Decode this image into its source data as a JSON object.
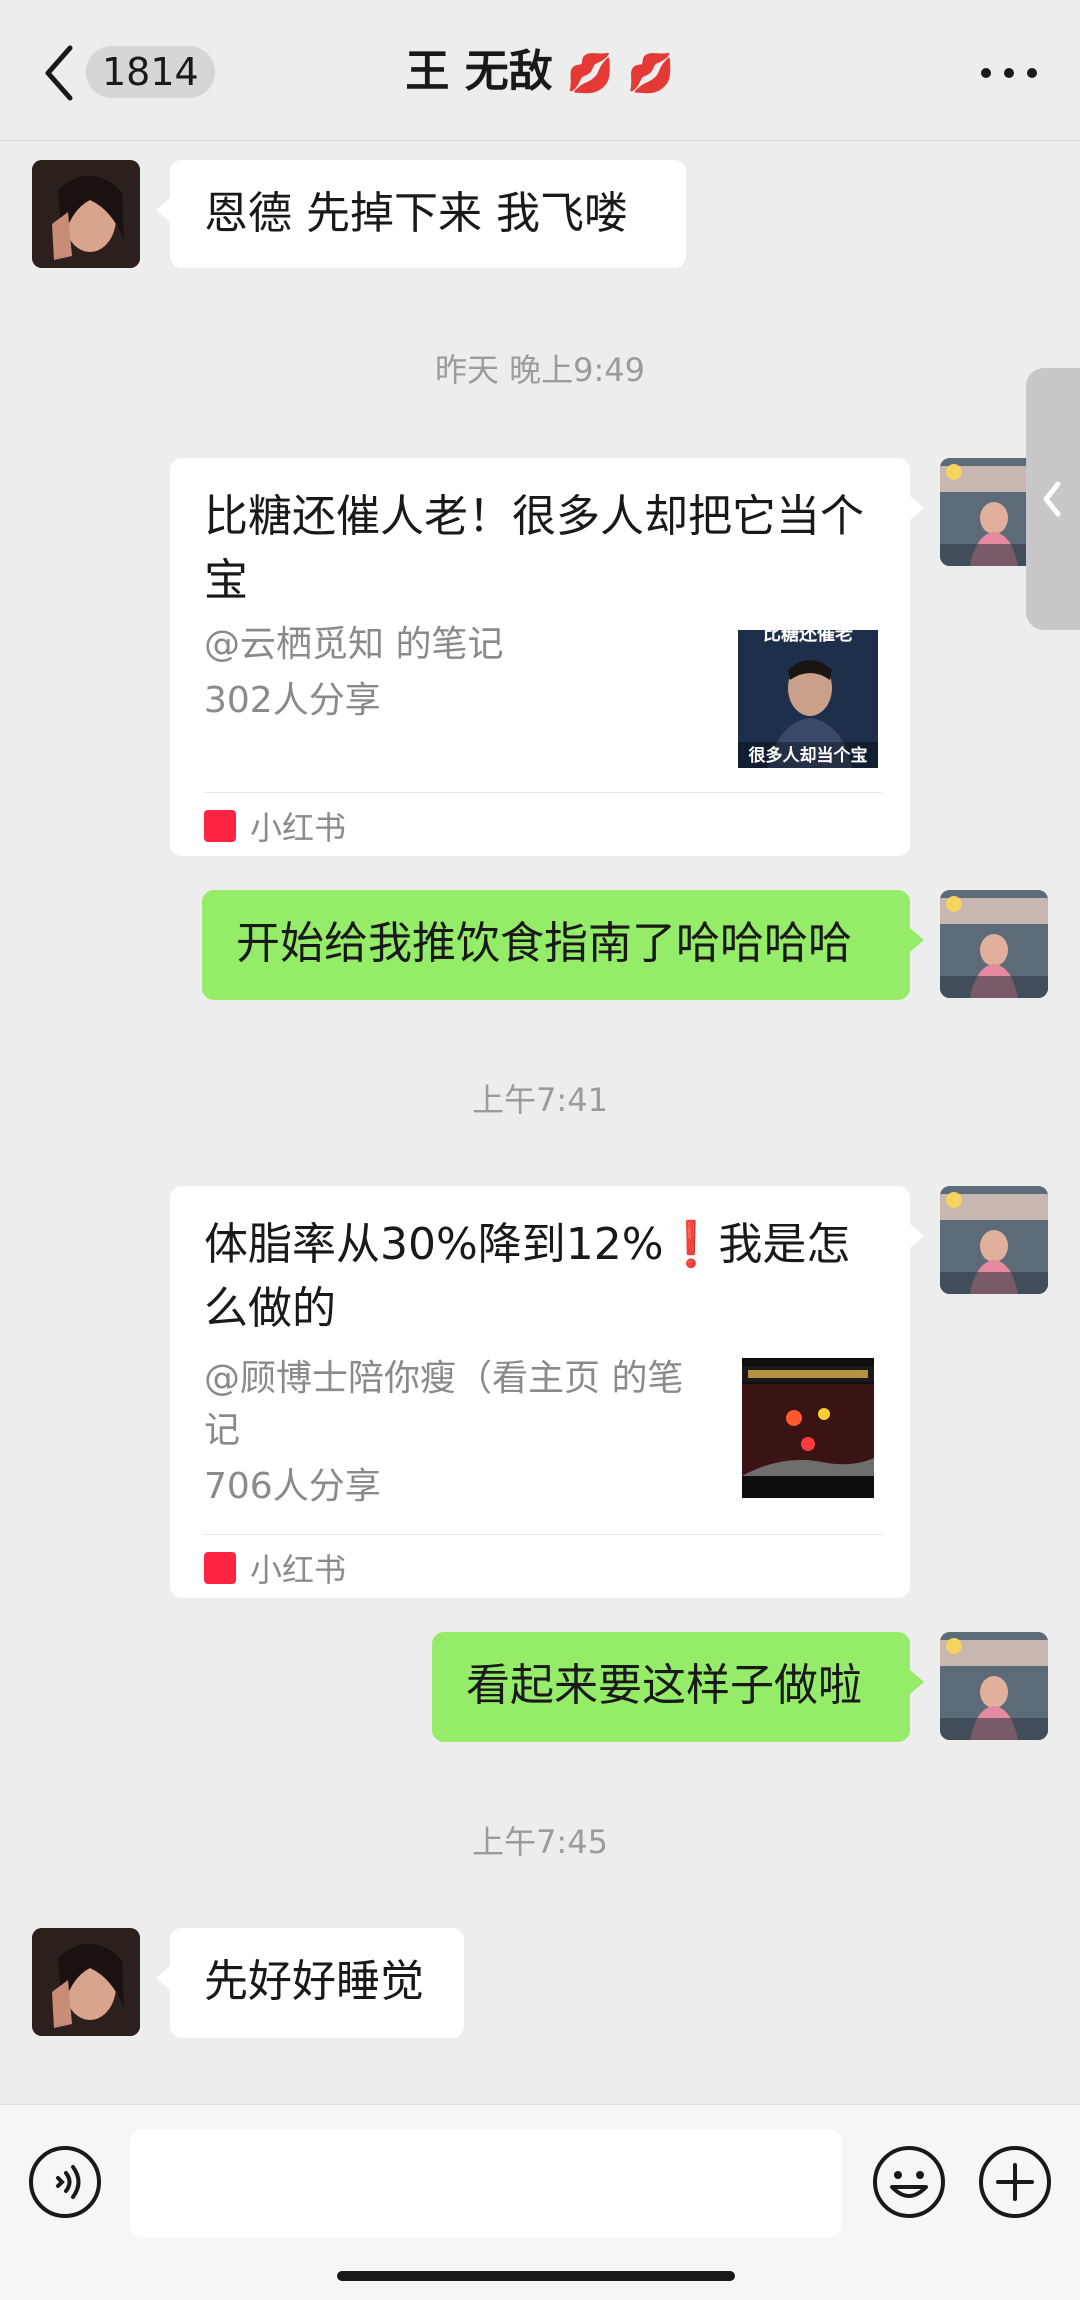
{
  "header": {
    "unread_count": "1814",
    "title": "王 无敌",
    "title_emoji": "💋 💋"
  },
  "messages": [
    {
      "text": "恩德 先掉下来 我飞喽"
    },
    {
      "text": "开始给我推饮食指南了哈哈哈哈"
    },
    {
      "text": "看起来要这样子做啦"
    },
    {
      "text": "先好好睡觉"
    }
  ],
  "timestamps": [
    "昨天 晚上9:49",
    "上午7:41",
    "上午7:45"
  ],
  "cards": [
    {
      "title_line1": "比糖还催人老！很多人却把它当个",
      "title_line2": "宝",
      "author": "@云栖觅知 的笔记",
      "shares": "302人分享",
      "thumb_top_text": "比糖还催老",
      "thumb_bottom_text": "很多人却当个宝",
      "source": "小红书"
    },
    {
      "title_line1": "体脂率从30%降到12%❗我是怎",
      "title_line2": "么做的",
      "author_line1": "@顾博士陪你瘦（看主页 的笔",
      "author_line2": "记",
      "shares": "706人分享",
      "source": "小红书"
    }
  ],
  "icons": {
    "back": "chevron-left-icon",
    "more": "more-dots-icon",
    "voice": "voice-icon",
    "emoji": "emoji-icon",
    "plus": "plus-icon",
    "side_tab": "chevron-left-icon"
  },
  "colors": {
    "background": "#ededed",
    "bubble_out": "#95ec69",
    "bubble_in": "#ffffff",
    "xhs_brand": "#ff2442"
  }
}
